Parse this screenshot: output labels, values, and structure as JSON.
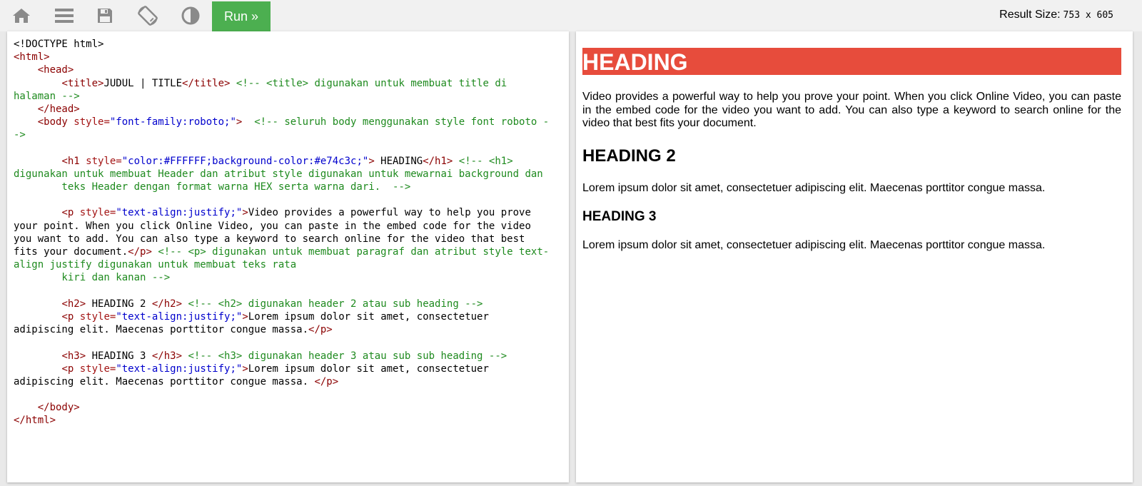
{
  "toolbar": {
    "run_label": "Run »",
    "result_size_label": "Result Size:",
    "result_size_value": "753 x 605",
    "icons": [
      "home-icon",
      "menu-icon",
      "save-icon",
      "rotate-icon",
      "contrast-icon"
    ]
  },
  "code_lines": [
    [
      [
        "p",
        "<!DOCTYPE html>"
      ]
    ],
    [
      [
        "t",
        "<html>"
      ]
    ],
    [
      [
        "p",
        "    "
      ],
      [
        "t",
        "<head>"
      ]
    ],
    [
      [
        "p",
        "        "
      ],
      [
        "t",
        "<title>"
      ],
      [
        "p",
        "JUDUL | TITLE"
      ],
      [
        "t",
        "</title>"
      ],
      [
        "p",
        " "
      ],
      [
        "c",
        "<!-- <title> digunakan untuk membuat title di"
      ]
    ],
    [
      [
        "c",
        "halaman -->"
      ]
    ],
    [
      [
        "p",
        "    "
      ],
      [
        "t",
        "</head>"
      ]
    ],
    [
      [
        "p",
        "    "
      ],
      [
        "t",
        "<body "
      ],
      [
        "a",
        "style="
      ],
      [
        "v",
        "\"font-family:roboto;\""
      ],
      [
        "t",
        ">"
      ],
      [
        "p",
        "  "
      ],
      [
        "c",
        "<!-- seluruh body menggunakan style font roboto -"
      ]
    ],
    [
      [
        "c",
        "->"
      ]
    ],
    [
      [
        "p",
        ""
      ]
    ],
    [
      [
        "p",
        "        "
      ],
      [
        "t",
        "<h1 "
      ],
      [
        "a",
        "style="
      ],
      [
        "v",
        "\"color:#FFFFFF;background-color:#e74c3c;\""
      ],
      [
        "t",
        ">"
      ],
      [
        "p",
        " HEADING"
      ],
      [
        "t",
        "</h1>"
      ],
      [
        "p",
        " "
      ],
      [
        "c",
        "<!-- <h1>"
      ]
    ],
    [
      [
        "c",
        "digunakan untuk membuat Header dan atribut style digunakan untuk mewarnai background dan"
      ]
    ],
    [
      [
        "c",
        "        teks Header dengan format warna HEX serta warna dari.  -->"
      ]
    ],
    [
      [
        "p",
        ""
      ]
    ],
    [
      [
        "p",
        "        "
      ],
      [
        "t",
        "<p "
      ],
      [
        "a",
        "style="
      ],
      [
        "v",
        "\"text-align:justify;\""
      ],
      [
        "t",
        ">"
      ],
      [
        "p",
        "Video provides a powerful way to help you prove"
      ]
    ],
    [
      [
        "p",
        "your point. When you click Online Video, you can paste in the embed code for the video"
      ]
    ],
    [
      [
        "p",
        "you want to add. You can also type a keyword to search online for the video that best"
      ]
    ],
    [
      [
        "p",
        "fits your document."
      ],
      [
        "t",
        "</p>"
      ],
      [
        "p",
        " "
      ],
      [
        "c",
        "<!-- <p> digunakan untuk membuat paragraf dan atribut style text-"
      ]
    ],
    [
      [
        "c",
        "align justify digunakan untuk membuat teks rata"
      ]
    ],
    [
      [
        "c",
        "        kiri dan kanan -->"
      ]
    ],
    [
      [
        "p",
        ""
      ]
    ],
    [
      [
        "p",
        "        "
      ],
      [
        "t",
        "<h2>"
      ],
      [
        "p",
        " HEADING 2 "
      ],
      [
        "t",
        "</h2>"
      ],
      [
        "p",
        " "
      ],
      [
        "c",
        "<!-- <h2> digunakan header 2 atau sub heading -->"
      ]
    ],
    [
      [
        "p",
        "        "
      ],
      [
        "t",
        "<p "
      ],
      [
        "a",
        "style="
      ],
      [
        "v",
        "\"text-align:justify;\""
      ],
      [
        "t",
        ">"
      ],
      [
        "p",
        "Lorem ipsum dolor sit amet, consectetuer"
      ]
    ],
    [
      [
        "p",
        "adipiscing elit. Maecenas porttitor congue massa."
      ],
      [
        "t",
        "</p>"
      ]
    ],
    [
      [
        "p",
        ""
      ]
    ],
    [
      [
        "p",
        "        "
      ],
      [
        "t",
        "<h3>"
      ],
      [
        "p",
        " HEADING 3 "
      ],
      [
        "t",
        "</h3>"
      ],
      [
        "p",
        " "
      ],
      [
        "c",
        "<!-- <h3> digunakan header 3 atau sub sub heading -->"
      ]
    ],
    [
      [
        "p",
        "        "
      ],
      [
        "t",
        "<p "
      ],
      [
        "a",
        "style="
      ],
      [
        "v",
        "\"text-align:justify;\""
      ],
      [
        "t",
        ">"
      ],
      [
        "p",
        "Lorem ipsum dolor sit amet, consectetuer"
      ]
    ],
    [
      [
        "p",
        "adipiscing elit. Maecenas porttitor congue massa. "
      ],
      [
        "t",
        "</p>"
      ]
    ],
    [
      [
        "p",
        ""
      ]
    ],
    [
      [
        "p",
        "    "
      ],
      [
        "t",
        "</body>"
      ]
    ],
    [
      [
        "t",
        "</html>"
      ]
    ]
  ],
  "result": {
    "h1": "HEADING",
    "h1_bg": "#e74c3c",
    "p1": "Video provides a powerful way to help you prove your point. When you click Online Video, you can paste in the embed code for the video you want to add. You can also type a keyword to search online for the video that best fits your document.",
    "h2": "HEADING 2",
    "p2": "Lorem ipsum dolor sit amet, consectetuer adipiscing elit. Maecenas porttitor congue massa.",
    "h3": "HEADING 3",
    "p3": "Lorem ipsum dolor sit amet, consectetuer adipiscing elit. Maecenas porttitor congue massa."
  },
  "colors": {
    "run_button": "#4caf50",
    "toolbar_bg": "#f1f1f1",
    "tag": "#8b0000",
    "attr": "#a31515",
    "value": "#0000cd",
    "comment": "#1e8a1e"
  }
}
